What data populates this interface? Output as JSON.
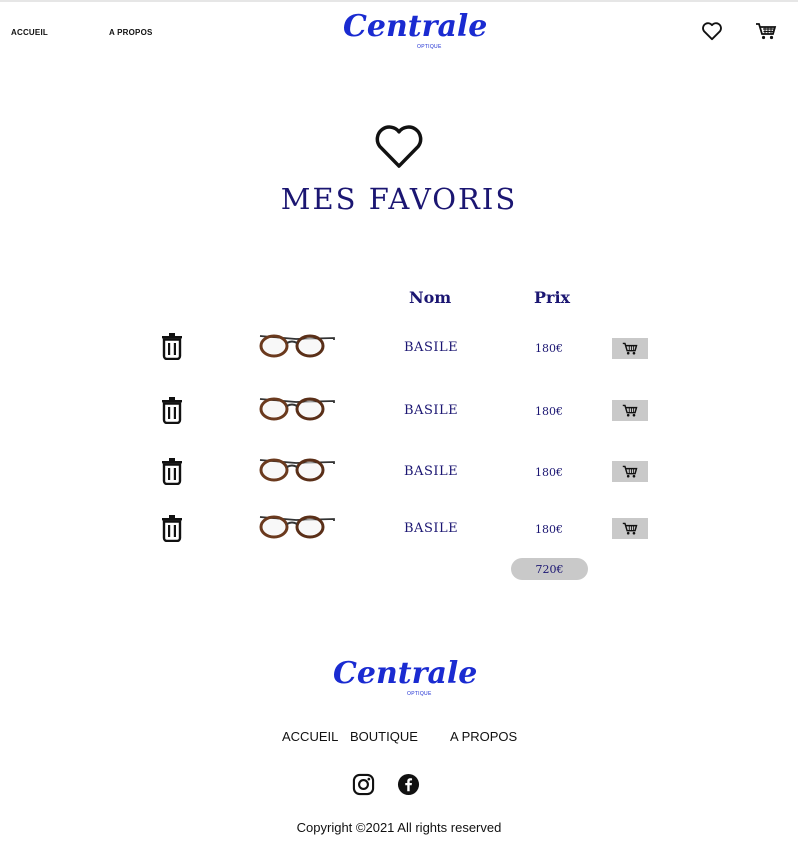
{
  "header": {
    "nav": [
      "ACCUEIL",
      "A PROPOS"
    ],
    "logo": {
      "script": "Centrale",
      "sub": "OPTIQUE"
    },
    "icons": [
      "heart-icon",
      "shopping-cart-icon"
    ]
  },
  "page": {
    "title": "MES FAVORIS",
    "title_icon": "heart-icon"
  },
  "table": {
    "columns": [
      "Nom",
      "Prix"
    ],
    "rows": [
      {
        "name": "BASILE",
        "price": "180€"
      },
      {
        "name": "BASILE",
        "price": "180€"
      },
      {
        "name": "BASILE",
        "price": "180€"
      },
      {
        "name": "BASILE",
        "price": "180€"
      }
    ],
    "total": "720€"
  },
  "footer": {
    "logo": {
      "script": "Centrale",
      "sub": "OPTIQUE"
    },
    "links": [
      "ACCUEIL",
      "BOUTIQUE",
      "A PROPOS"
    ],
    "social": [
      "instagram-icon",
      "facebook-icon"
    ],
    "copyright": "Copyright ©2021 All rights reserved"
  },
  "colors": {
    "brand_blue": "#1a2bd1",
    "title_navy": "#1b1672",
    "button_gray": "#c9c9c9"
  }
}
